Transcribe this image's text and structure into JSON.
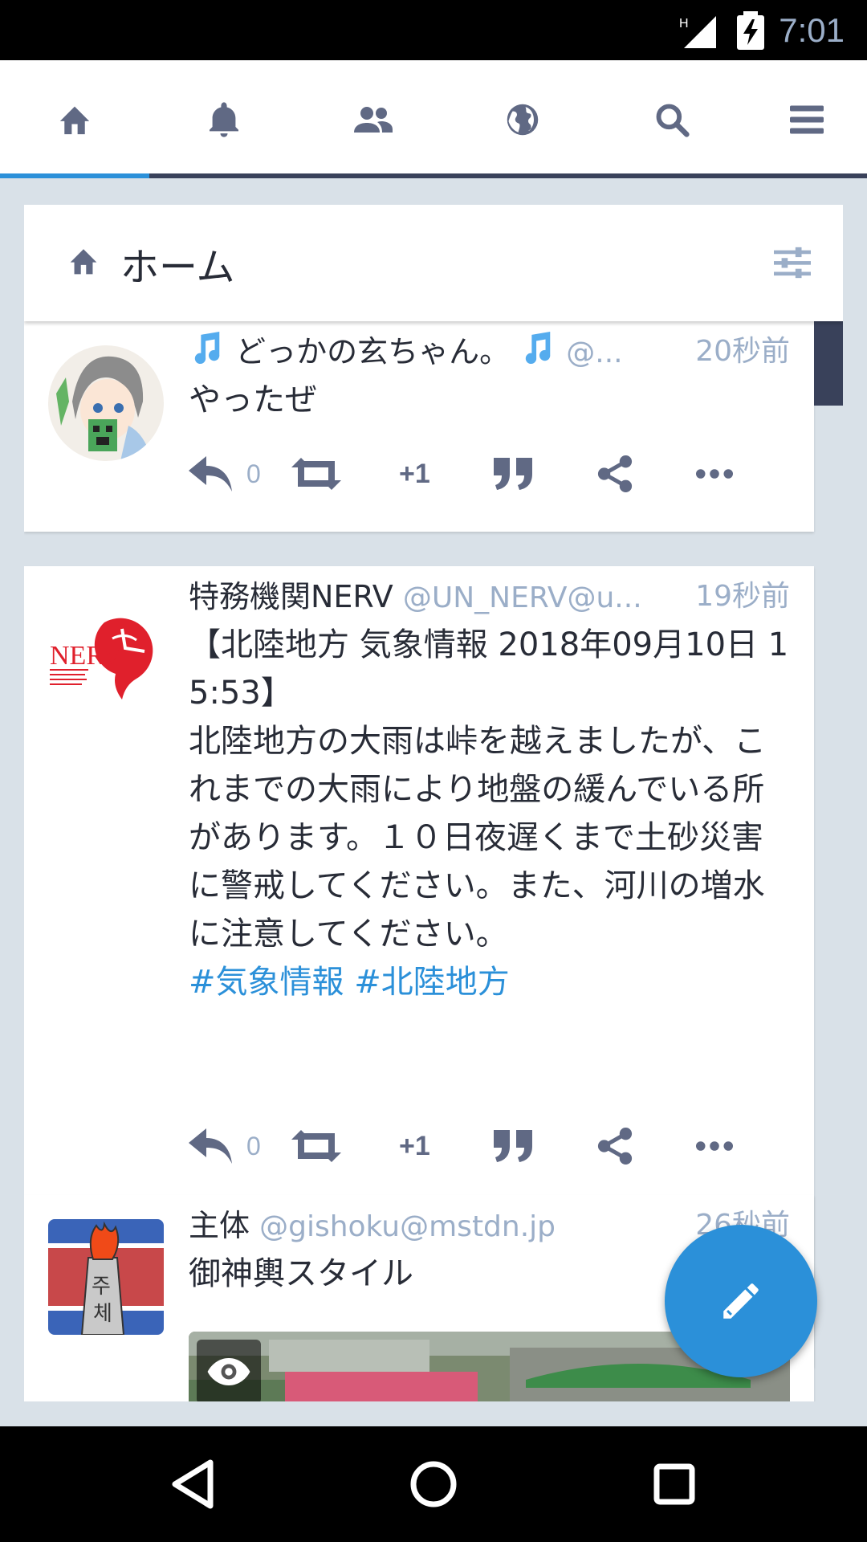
{
  "status_bar": {
    "time": "7:01",
    "network": "H"
  },
  "tabs": [
    {
      "icon": "home-icon",
      "active": true
    },
    {
      "icon": "bell-icon",
      "active": false
    },
    {
      "icon": "people-icon",
      "active": false
    },
    {
      "icon": "globe-icon",
      "active": false
    },
    {
      "icon": "search-icon",
      "active": false
    },
    {
      "icon": "menu-icon",
      "active": false
    }
  ],
  "column": {
    "title": "ホーム"
  },
  "statuses": [
    {
      "display_name": "どっかの玄ちゃん。",
      "acct": "@...",
      "time": "20秒前",
      "content": "やったぜ",
      "hashtags": "",
      "reply_count": "0",
      "favourite_label": "+1"
    },
    {
      "display_name": "特務機関NERV",
      "acct": "@UN_NERV@u...",
      "time": "19秒前",
      "content": "【北陸地方 気象情報 2018年09月10日 15:53】\n北陸地方の大雨は峠を越えましたが、これまでの大雨により地盤の緩んでいる所があります。１０日夜遅くまで土砂災害に警戒してください。また、河川の増水に注意してください。",
      "hashtags": "#気象情報 #北陸地方",
      "reply_count": "0",
      "favourite_label": "+1"
    },
    {
      "display_name": "主体",
      "acct": "@gishoku@mstdn.jp",
      "time": "26秒前",
      "content": "御神輿スタイル"
    }
  ],
  "avatar_text": {
    "nerv": "NERV",
    "juche_1": "주",
    "juche_2": "체"
  },
  "colors": {
    "accent": "#2b90d9",
    "text": "#282c37",
    "muted": "#9baec8",
    "background": "#d9e1e8"
  }
}
